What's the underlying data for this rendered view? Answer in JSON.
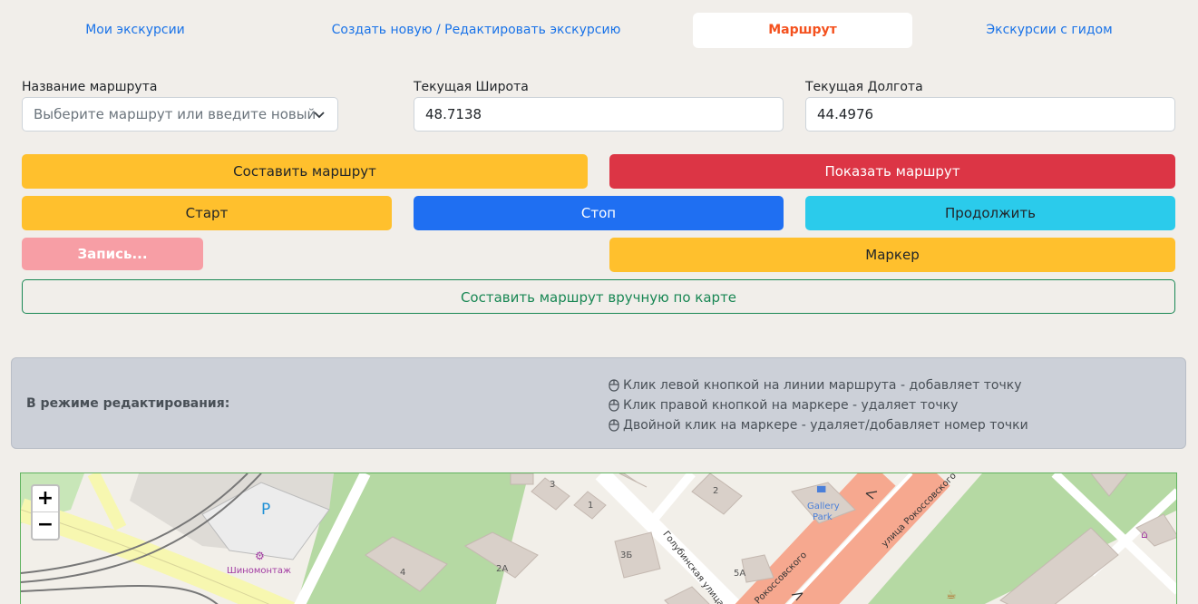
{
  "tabs": [
    {
      "label": "Мои экскурсии"
    },
    {
      "label": "Создать новую / Редактировать экскурсию"
    },
    {
      "label": "Маршрут"
    },
    {
      "label": "Экскурсии с гидом"
    }
  ],
  "form": {
    "route_name_label": "Название маршрута",
    "route_name_placeholder": "Выберите маршрут или введите новый",
    "lat_label": "Текущая Широта",
    "lat_value": "48.7138",
    "lon_label": "Текущая Долгота",
    "lon_value": "44.4976"
  },
  "buttons": {
    "build_route": "Составить маршрут",
    "show_route": "Показать маршрут",
    "start": "Старт",
    "stop": "Стоп",
    "continue": "Продолжить",
    "recording": "Запись...",
    "marker": "Маркер",
    "manual_route": "Составить маршрут вручную по карте"
  },
  "info": {
    "title": "В режиме редактирования:",
    "hints": [
      "Клик левой кнопкой на линии маршрута - добавляет точку",
      "Клик правой кнопкой на маркере - удаляет точку",
      "Двойной клик на маркере - удаляет/добавляет номер точки"
    ]
  },
  "map": {
    "zoom_in": "+",
    "zoom_out": "−",
    "labels": {
      "parking": "P",
      "tire_shop": "Шиномонтаж",
      "gallery1": "Gallery",
      "gallery2": "Park",
      "street1": "улица Рокоссовского",
      "street2": "Голубинская улица",
      "street3": "Рокоссовского",
      "b3": "3",
      "b1": "1",
      "b2": "2",
      "b3b": "3Б",
      "b5a": "5А",
      "b4": "4",
      "b2a": "2А"
    }
  },
  "colors": {
    "accent": "#f4511e",
    "link": "#1a73e8",
    "yellow": "#ffc02d",
    "red": "#dc3545",
    "blue": "#1f6ff2",
    "cyan": "#2bcbeb",
    "green": "#198754"
  }
}
